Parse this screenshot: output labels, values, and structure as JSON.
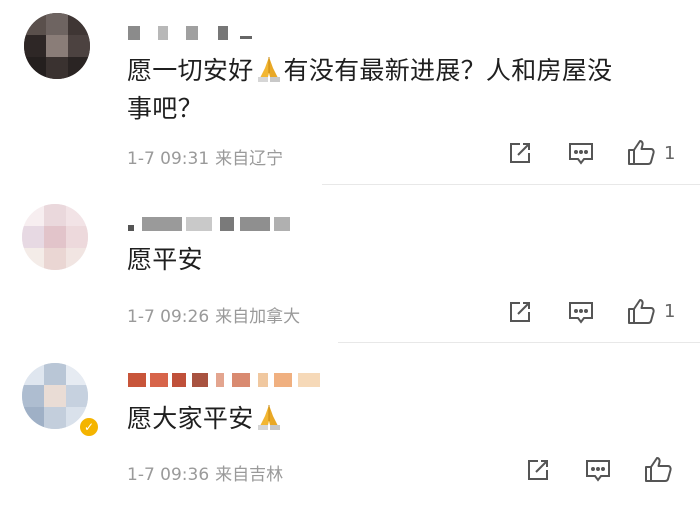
{
  "comments": [
    {
      "text_line1": "愿一切安好",
      "text_line1b": "有没有最新进展？人和房屋没",
      "text_line2": "事吧？",
      "time": "1-7 09:31",
      "source": "来自辽宁",
      "likes": "1"
    },
    {
      "text": "愿平安",
      "time": "1-7 09:26",
      "source": "来自加拿大",
      "likes": "1"
    },
    {
      "text": "愿大家平安",
      "time": "1-7 09:36",
      "source": "来自吉林",
      "likes": ""
    }
  ],
  "icons": {
    "repost": "share-icon",
    "comment": "comment-icon",
    "like": "thumbs-up-icon",
    "emoji": "praying-hands-emoji",
    "verified": "verified-badge-icon"
  }
}
